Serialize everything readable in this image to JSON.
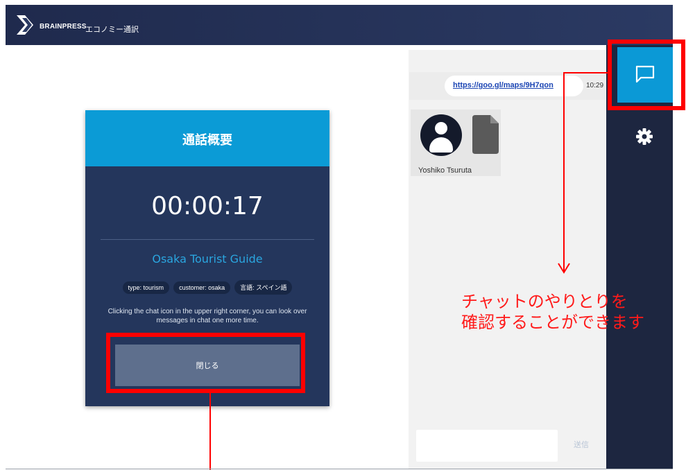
{
  "header": {
    "brand": "BRAINPRESS",
    "subtitle": "エコノミー通訳"
  },
  "modal": {
    "title": "通話概要",
    "timer": "00:00:17",
    "guide_name": "Osaka Tourist Guide",
    "tags": [
      "type: tourism",
      "customer: osaka",
      "言語: スペイン語"
    ],
    "description": "Clicking the chat icon in the upper right corner, you can look over messages in chat one more time.",
    "close_label": "閉じる"
  },
  "chat": {
    "link": "https://goo.gl/maps/9H7qon",
    "time": "10:29",
    "username": "Yoshiko Tsuruta",
    "input_value": "",
    "send_label": "送信"
  },
  "sidebar": {
    "icons": [
      "chat-icon",
      "gear-icon"
    ]
  },
  "annotation": {
    "line1": "チャットのやりとりを",
    "line2": "確認することができます"
  },
  "colors": {
    "accent": "#0b9bd6",
    "modal_bg": "#24365c",
    "highlight": "#ff0000",
    "sidebar_bg": "#1d2640"
  }
}
